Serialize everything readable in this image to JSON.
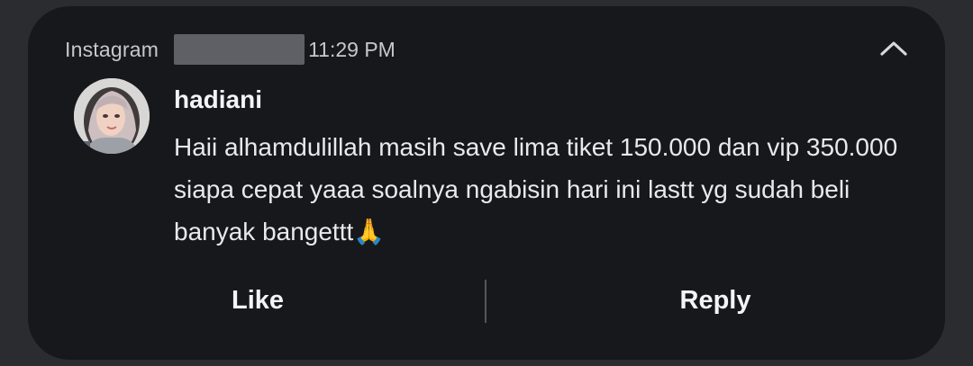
{
  "notification": {
    "app_name": "Instagram",
    "time": "11:29 PM",
    "sender": "hadiani",
    "message": "Haii alhamdulillah masih save lima tiket 150.000 dan vip 350.000 siapa cepat yaaa soalnya ngabisin hari ini lastt yg sudah beli banyak bangettt🙏",
    "collapse_icon": "chevron-up-icon",
    "avatar_icon": "avatar"
  },
  "actions": {
    "like_label": "Like",
    "reply_label": "Reply"
  },
  "colors": {
    "background": "#2b2c30",
    "card": "#17181c",
    "text": "#ffffff",
    "muted_text": "#c7c8cc",
    "redaction": "#5f6065",
    "divider": "#55565b"
  }
}
